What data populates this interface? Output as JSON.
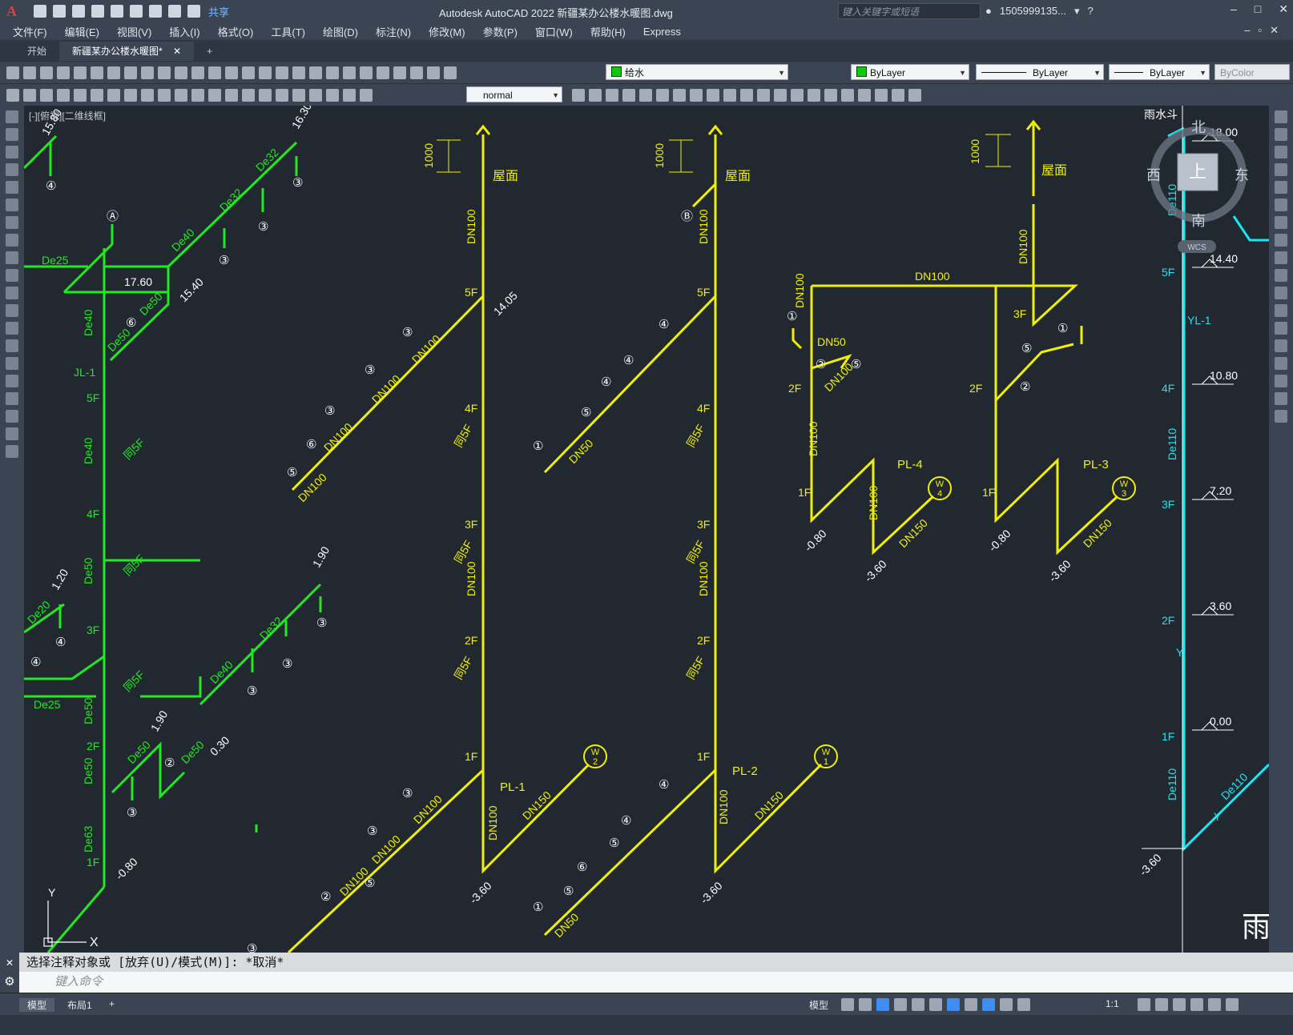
{
  "app": {
    "logo": "A",
    "title": "Autodesk AutoCAD 2022    新疆某办公楼水暖图.dwg",
    "share_label": "共享",
    "search_placeholder": "键入关键字或短语",
    "user": "1505999135...",
    "window_controls": [
      "–",
      "□",
      "✕"
    ]
  },
  "menu": [
    "文件(F)",
    "编辑(E)",
    "视图(V)",
    "插入(I)",
    "格式(O)",
    "工具(T)",
    "绘图(D)",
    "标注(N)",
    "修改(M)",
    "参数(P)",
    "窗口(W)",
    "帮助(H)",
    "Express"
  ],
  "tabs": [
    {
      "label": "开始",
      "active": false
    },
    {
      "label": "新疆某办公楼水暖图*",
      "active": true
    }
  ],
  "toolbar": {
    "layer": "给水",
    "color": "ByLayer",
    "linetype": "ByLayer",
    "lineweight": "ByLayer",
    "plotstyle": "ByColor",
    "textstyle": "normal"
  },
  "viewport": {
    "label": "[-][俯视][二维线框]",
    "viewcube": {
      "n": "北",
      "s": "南",
      "e": "东",
      "w": "西",
      "top": "上",
      "wcs": "WCS"
    }
  },
  "drawing": {
    "green": {
      "elev": [
        "15.80",
        "16.30",
        "17.60",
        "15.40",
        "1.20",
        "1.90",
        "1.90",
        "0.30",
        "-0.80"
      ],
      "pipes": [
        "De25",
        "De40",
        "De32",
        "De32",
        "De40",
        "De50",
        "De50",
        "De40",
        "De50",
        "De50",
        "De20",
        "De25",
        "De40",
        "De32",
        "De50",
        "De63",
        "De50",
        "De50"
      ],
      "floors": [
        "5F",
        "4F",
        "3F",
        "2F",
        "1F"
      ],
      "riser": "JL-1",
      "same": [
        "同5F",
        "同5F",
        "同5F"
      ],
      "markers": [
        "④",
        "③",
        "③",
        "③",
        "Ⓐ",
        "⑥",
        "④",
        "④",
        "③",
        "③",
        "③",
        "②",
        "③",
        "③"
      ]
    },
    "yellow": {
      "roof": "屋面",
      "h1000": "1000",
      "pipes": [
        "DN100",
        "DN100",
        "DN100",
        "DN100",
        "DN100",
        "DN100",
        "DN100",
        "DN100",
        "DN100",
        "DN100",
        "DN100",
        "DN150",
        "DN150",
        "DN100",
        "DN100",
        "DN50",
        "DN50",
        "DN100",
        "DN100",
        "DN50",
        "DN100",
        "DN100",
        "DN100",
        "DN150",
        "DN100",
        "DN150"
      ],
      "floors": [
        "5F",
        "4F",
        "3F",
        "2F",
        "1F"
      ],
      "same": [
        "同5F",
        "同5F",
        "同5F"
      ],
      "risers": [
        "PL-1",
        "PL-2",
        "PL-4",
        "PL-3"
      ],
      "elev": [
        "14.05",
        "-3.60",
        "-3.60",
        "-0.80",
        "-3.60",
        "-0.80",
        "-3.60"
      ],
      "wells": [
        {
          "top": "W",
          "bottom": "2"
        },
        {
          "top": "W",
          "bottom": "1"
        },
        {
          "top": "W",
          "bottom": "4"
        },
        {
          "top": "W",
          "bottom": "3"
        }
      ],
      "markers": [
        "③",
        "③",
        "③",
        "⑥",
        "⑤",
        "Ⓑ",
        "④",
        "④",
        "④",
        "⑤",
        "①",
        "③",
        "③",
        "②",
        "⑤",
        "④",
        "④",
        "⑤",
        "⑥",
        "⑤",
        "①",
        "①",
        "②",
        "⑤",
        "①",
        "⑤",
        "②"
      ]
    },
    "cyan": {
      "title": "雨水斗",
      "riser": "YL-1",
      "pipes": [
        "De110",
        "De110",
        "De110",
        "De110"
      ],
      "elev": [
        "18.00",
        "14.40",
        "10.80",
        "7.20",
        "3.60",
        "0.00",
        "-3.60"
      ],
      "floors": [
        "5F",
        "4F",
        "3F",
        "2F",
        "1F"
      ],
      "y": "Y",
      "partial": "雨"
    },
    "ucs": {
      "x": "X",
      "y": "Y"
    }
  },
  "command": {
    "history": "选择注释对象或 [放弃(U)/模式(M)]: *取消*",
    "placeholder": "键入命令"
  },
  "status": {
    "layouts": [
      "模型",
      "布局1"
    ],
    "add": "+",
    "model": "模型",
    "scale": "1:1"
  }
}
